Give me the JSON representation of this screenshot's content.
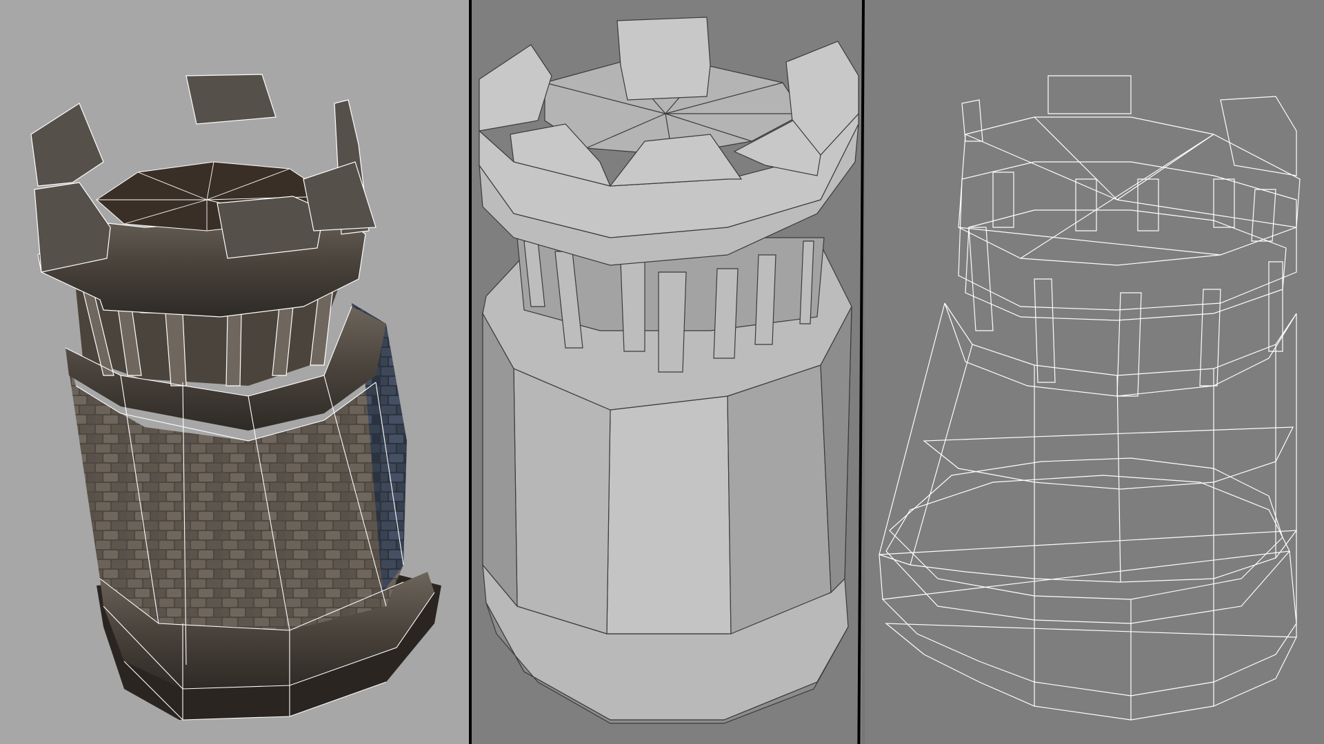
{
  "scene": {
    "panels": [
      {
        "view_mode": "textured-with-wireframe-overlay"
      },
      {
        "view_mode": "flat-shaded"
      },
      {
        "view_mode": "wireframe"
      }
    ],
    "colors": {
      "bg_textured": "#a7a7a7",
      "bg_shaded": "#7f7f7f",
      "bg_wire": "#7e7e7e",
      "divider": "#000000",
      "stone_dark": "#3b3630",
      "stone_mid": "#5a5249",
      "shaded_light": "#b9b9b9",
      "wire": "#ffffff"
    },
    "icons": [
      "tower-model-textured-icon",
      "tower-model-shaded-icon",
      "tower-model-wireframe-icon"
    ]
  }
}
